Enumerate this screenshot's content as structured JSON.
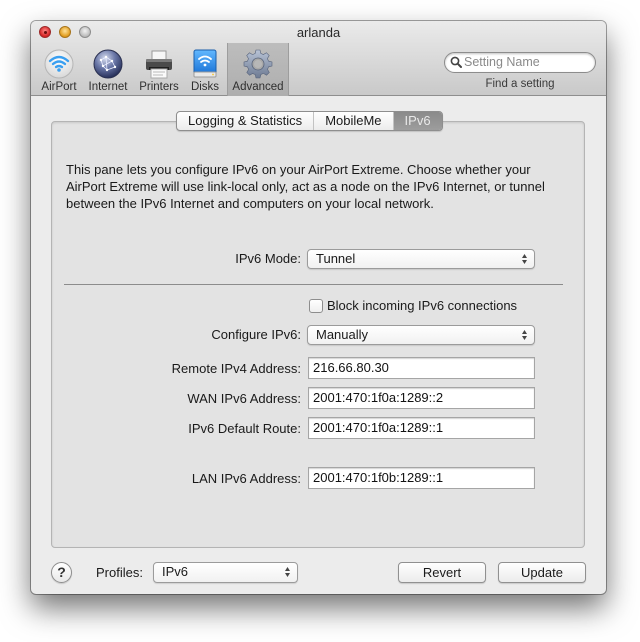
{
  "window": {
    "title": "arlanda"
  },
  "toolbar": {
    "items": [
      {
        "label": "AirPort",
        "icon": "airport-wifi-icon"
      },
      {
        "label": "Internet",
        "icon": "internet-globe-icon"
      },
      {
        "label": "Printers",
        "icon": "printer-icon"
      },
      {
        "label": "Disks",
        "icon": "disk-icon"
      },
      {
        "label": "Advanced",
        "icon": "gear-icon",
        "selected": true
      }
    ],
    "search": {
      "placeholder": "Setting Name",
      "caption": "Find a setting"
    }
  },
  "tabs": [
    {
      "label": "Logging & Statistics",
      "active": false
    },
    {
      "label": "MobileMe",
      "active": false
    },
    {
      "label": "IPv6",
      "active": true
    }
  ],
  "pane": {
    "description": "This pane lets you configure IPv6 on your AirPort Extreme. Choose whether your AirPort Extreme will use link-local only, act as a node on the IPv6 Internet, or tunnel between the IPv6 Internet and computers on your local network.",
    "ipv6_mode": {
      "label": "IPv6 Mode:",
      "value": "Tunnel"
    },
    "block_incoming": {
      "label": "Block incoming IPv6 connections",
      "checked": false
    },
    "configure_ipv6": {
      "label": "Configure IPv6:",
      "value": "Manually"
    },
    "remote_ipv4": {
      "label": "Remote IPv4 Address:",
      "value": "216.66.80.30"
    },
    "wan_ipv6": {
      "label": "WAN IPv6 Address:",
      "value": "2001:470:1f0a:1289::2"
    },
    "default_route": {
      "label": "IPv6 Default Route:",
      "value": "2001:470:1f0a:1289::1"
    },
    "lan_ipv6": {
      "label": "LAN IPv6 Address:",
      "value": "2001:470:1f0b:1289::1"
    }
  },
  "footer": {
    "help_label": "?",
    "profiles_label": "Profiles:",
    "profiles_value": "IPv6",
    "revert_label": "Revert",
    "update_label": "Update"
  }
}
